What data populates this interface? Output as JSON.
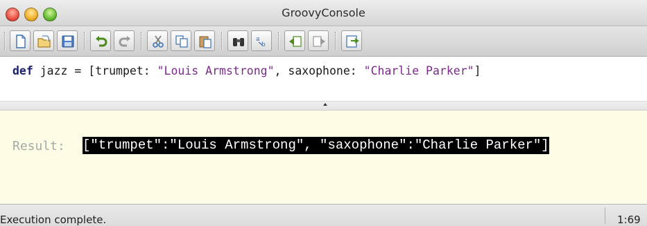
{
  "window": {
    "title": "GroovyConsole",
    "controls": [
      "close",
      "minimize",
      "zoom"
    ]
  },
  "toolbar": {
    "buttons": [
      {
        "name": "new-file",
        "icon": "new-document-icon"
      },
      {
        "name": "open-file",
        "icon": "open-folder-icon"
      },
      {
        "name": "save-file",
        "icon": "save-disk-icon"
      },
      {
        "name": "undo",
        "icon": "undo-arrow-icon"
      },
      {
        "name": "redo",
        "icon": "redo-arrow-icon"
      },
      {
        "name": "cut",
        "icon": "scissors-icon"
      },
      {
        "name": "copy",
        "icon": "copy-icon"
      },
      {
        "name": "paste",
        "icon": "paste-clipboard-icon"
      },
      {
        "name": "find",
        "icon": "binoculars-icon"
      },
      {
        "name": "replace",
        "icon": "find-replace-icon"
      },
      {
        "name": "history-previous",
        "icon": "history-back-icon"
      },
      {
        "name": "history-next",
        "icon": "history-forward-icon"
      },
      {
        "name": "run-script",
        "icon": "run-script-icon"
      }
    ]
  },
  "editor": {
    "code": {
      "keyword": "def",
      "decl": " jazz = [trumpet: ",
      "str1": "\"Louis Armstrong\"",
      "mid": ", saxophone: ",
      "str2": "\"Charlie Parker\"",
      "end": "]"
    }
  },
  "output": {
    "label": "Result:",
    "value": "[\"trumpet\":\"Louis Armstrong\", \"saxophone\":\"Charlie Parker\"]"
  },
  "status": {
    "message": "Execution complete.",
    "caret_position": "1:69"
  },
  "colors": {
    "output_background": "#fdfde6",
    "keyword": "#1a1f6e",
    "string": "#7a2b8a",
    "result_label": "#a8a8a8"
  }
}
